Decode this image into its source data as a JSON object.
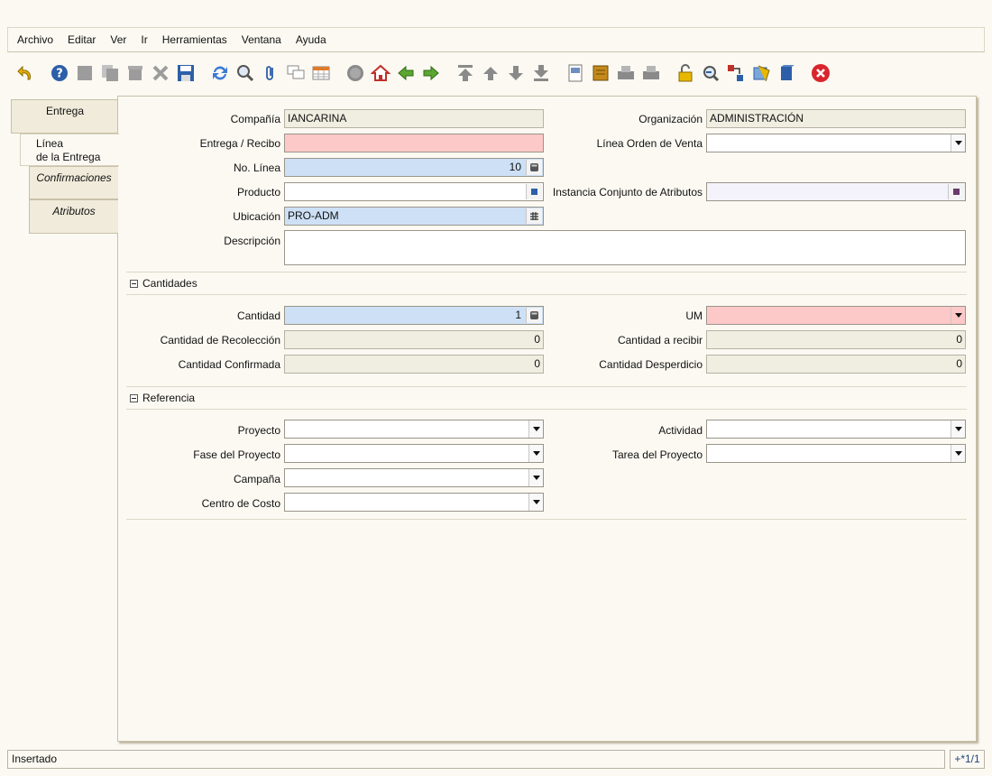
{
  "menu": [
    "Archivo",
    "Editar",
    "Ver",
    "Ir",
    "Herramientas",
    "Ventana",
    "Ayuda"
  ],
  "tabs": {
    "entrega": "Entrega",
    "linea_1": "Línea",
    "linea_2": "de la Entrega",
    "confirmaciones": "Confirmaciones",
    "atributos": "Atributos"
  },
  "form": {
    "compania": {
      "label": "Compañía",
      "value": "IANCARINA"
    },
    "organizacion": {
      "label": "Organización",
      "value": "ADMINISTRACIÓN"
    },
    "entrega_recibo": {
      "label": "Entrega / Recibo",
      "value": ""
    },
    "linea_orden_venta": {
      "label": "Línea Orden de Venta",
      "value": ""
    },
    "no_linea": {
      "label": "No. Línea",
      "value": "10"
    },
    "producto": {
      "label": "Producto",
      "value": ""
    },
    "instancia": {
      "label": "Instancia Conjunto de Atributos",
      "value": ""
    },
    "ubicacion": {
      "label": "Ubicación",
      "value": "PRO-ADM"
    },
    "descripcion": {
      "label": "Descripción",
      "value": ""
    }
  },
  "cantidades": {
    "title": "Cantidades",
    "cantidad": {
      "label": "Cantidad",
      "value": "1"
    },
    "um": {
      "label": "UM",
      "value": ""
    },
    "recoleccion": {
      "label": "Cantidad de Recolección",
      "value": "0"
    },
    "a_recibir": {
      "label": "Cantidad a recibir",
      "value": "0"
    },
    "confirmada": {
      "label": "Cantidad Confirmada",
      "value": "0"
    },
    "desperdicio": {
      "label": "Cantidad Desperdicio",
      "value": "0"
    }
  },
  "referencia": {
    "title": "Referencia",
    "proyecto": {
      "label": "Proyecto",
      "value": ""
    },
    "actividad": {
      "label": "Actividad",
      "value": ""
    },
    "fase": {
      "label": "Fase del Proyecto",
      "value": ""
    },
    "tarea": {
      "label": "Tarea del Proyecto",
      "value": ""
    },
    "campana": {
      "label": "Campaña",
      "value": ""
    },
    "centro_costo": {
      "label": "Centro de Costo",
      "value": ""
    }
  },
  "status": {
    "message": "Insertado",
    "record": "+*1/1"
  },
  "icons": {
    "toolbar": [
      "undo-icon",
      "help-icon",
      "new-record-icon",
      "copy-record-icon",
      "delete-record-icon",
      "delete-selection-icon",
      "save-icon",
      "refresh-icon",
      "find-icon",
      "attachment-icon",
      "chat-icon",
      "grid-toggle-icon",
      "history-icon",
      "home-icon",
      "parent-record-icon",
      "detail-record-icon",
      "first-record-icon",
      "previous-record-icon",
      "next-record-icon",
      "last-record-icon",
      "report-icon",
      "archived-documents-icon",
      "print-preview-icon",
      "print-icon",
      "lock-icon",
      "zoom-across-icon",
      "active-workflows-icon",
      "requests-icon",
      "product-info-icon",
      "exit-icon"
    ]
  }
}
